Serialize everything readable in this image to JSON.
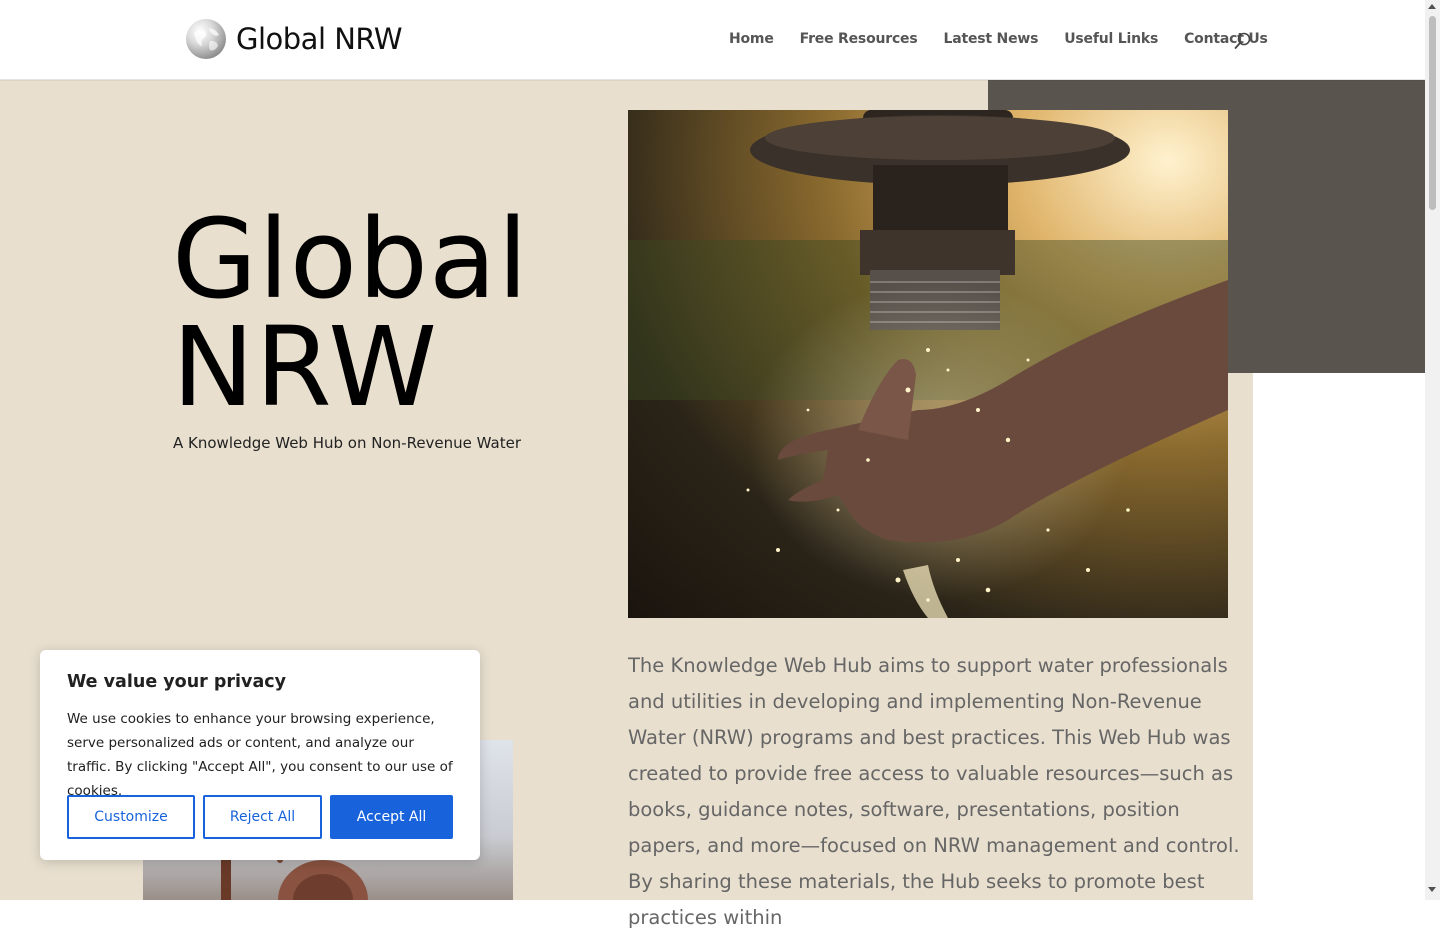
{
  "header": {
    "logo_text": "Global NRW",
    "nav": [
      "Home",
      "Free Resources",
      "Latest News",
      "Useful Links",
      "Contact Us"
    ]
  },
  "hero": {
    "title_line1": "Global",
    "title_line2": "NRW",
    "subtitle": "A Knowledge Web Hub on Non-Revenue Water",
    "body": "The Knowledge Web Hub aims to support water professionals and utilities in developing and implementing Non-Revenue Water (NRW) programs and best practices. This Web Hub was created to provide free access to valuable resources—such as books, guidance notes, software, presentations, position papers, and more—focused on NRW management and control. By sharing these materials, the Hub seeks to promote best practices within"
  },
  "cookie_banner": {
    "title": "We value your privacy",
    "text": "We use cookies to enhance your browsing experience, serve personalized ads or content, and analyze our traffic. By clicking \"Accept All\", you consent to our use of cookies.",
    "customize_label": "Customize",
    "reject_label": "Reject All",
    "accept_label": "Accept All"
  },
  "colors": {
    "hero_bg": "#e8dfcf",
    "dark_block": "#5a544e",
    "accent": "#1863dc"
  }
}
